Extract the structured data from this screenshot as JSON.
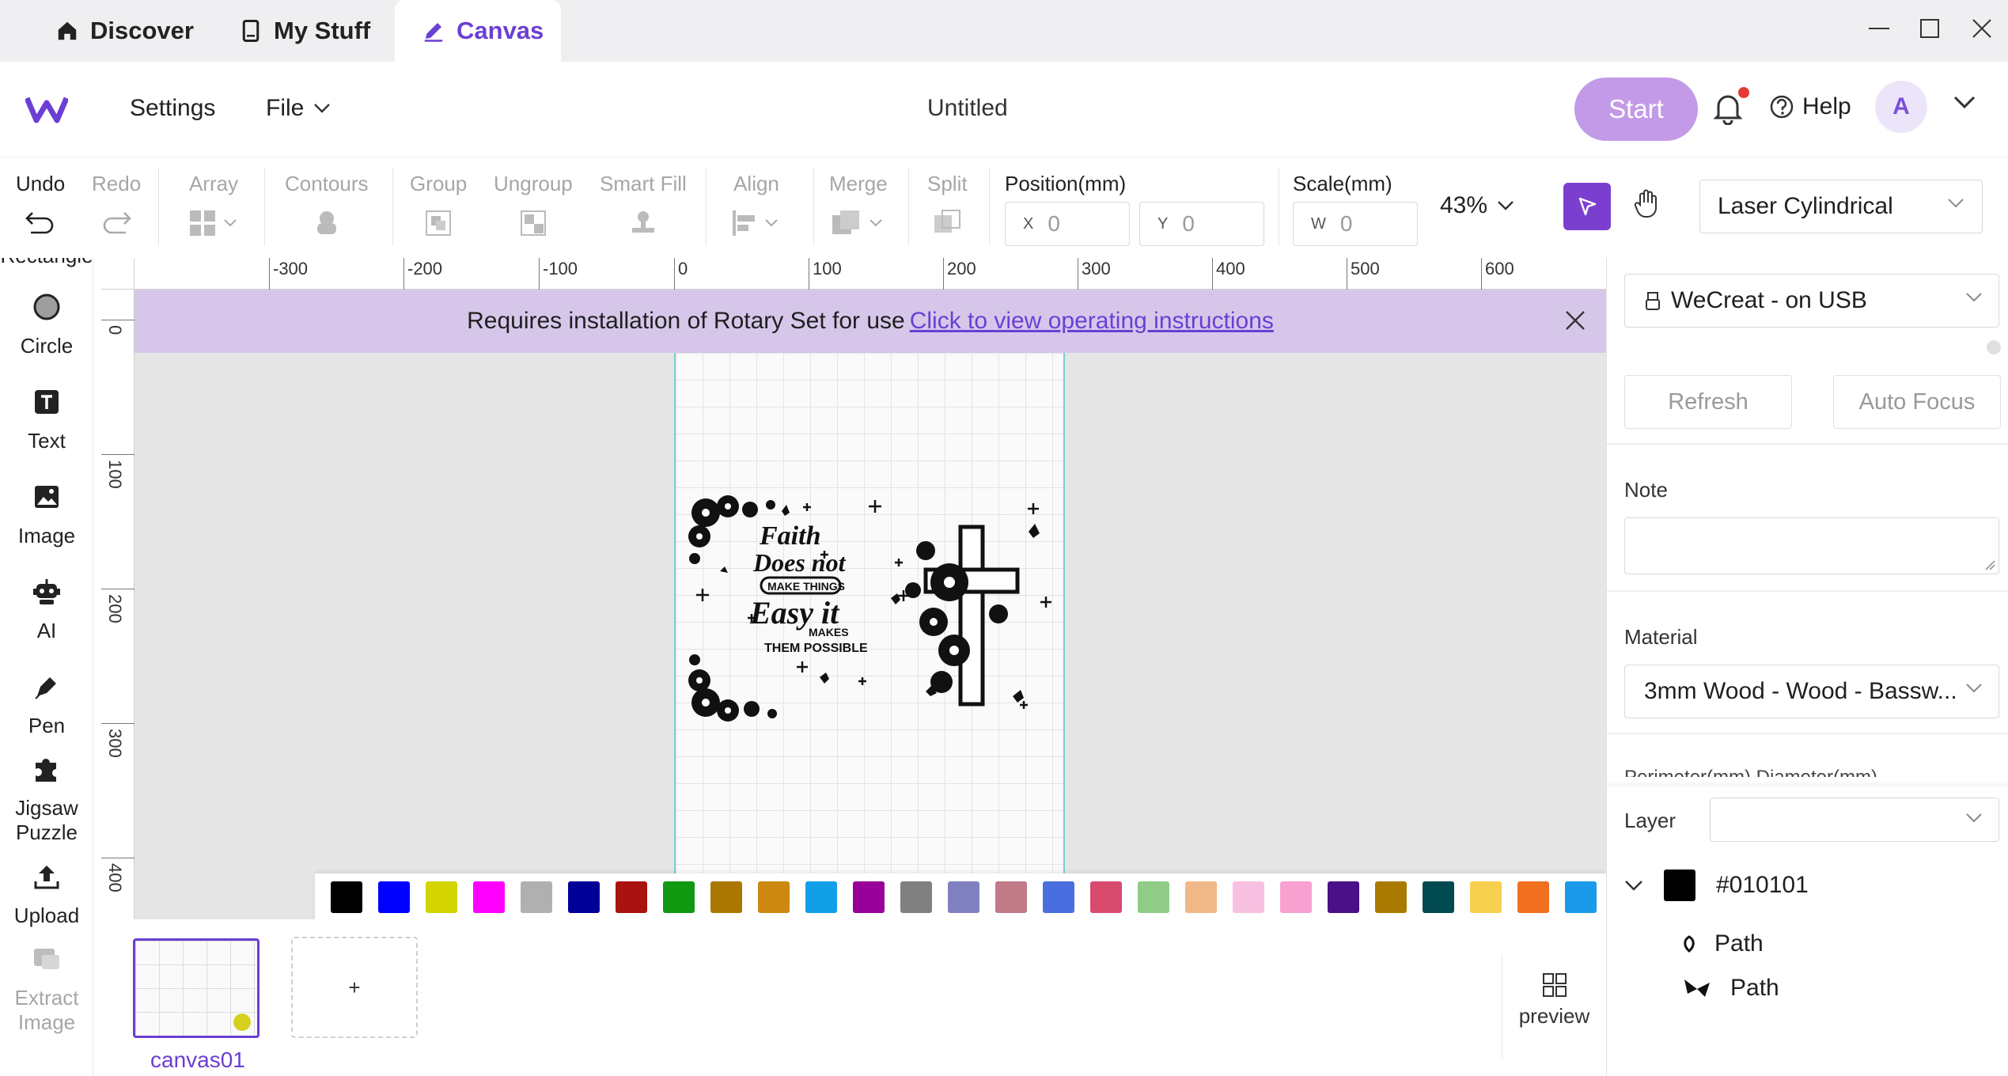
{
  "tabs": {
    "discover": "Discover",
    "my_stuff": "My Stuff",
    "canvas": "Canvas"
  },
  "header": {
    "settings": "Settings",
    "file": "File",
    "title": "Untitled",
    "start": "Start",
    "help": "Help",
    "avatar_letter": "A"
  },
  "toolbar": {
    "undo": "Undo",
    "redo": "Redo",
    "array": "Array",
    "contours": "Contours",
    "group": "Group",
    "ungroup": "Ungroup",
    "smart_fill": "Smart Fill",
    "align": "Align",
    "merge": "Merge",
    "split": "Split",
    "position_label": "Position(mm)",
    "pos_x_prefix": "X",
    "pos_x": "0",
    "pos_y_prefix": "Y",
    "pos_y": "0",
    "scale_label": "Scale(mm)",
    "scale_w_prefix": "W",
    "scale_w": "0",
    "zoom": "43%",
    "machine": "Laser Cylindrical"
  },
  "left_tools": {
    "rectangle_partial": "Rectangle",
    "circle": "Circle",
    "text": "Text",
    "image": "Image",
    "ai": "AI",
    "pen": "Pen",
    "jigsaw_line1": "Jigsaw",
    "jigsaw_line2": "Puzzle",
    "upload": "Upload",
    "extract_line1": "Extract",
    "extract_line2": "Image"
  },
  "rulers": {
    "horizontal": [
      "-300",
      "-200",
      "-100",
      "0",
      "100",
      "200",
      "300",
      "400",
      "500",
      "600"
    ],
    "vertical": [
      "0",
      "100",
      "200",
      "300",
      "400"
    ]
  },
  "notice": {
    "text": "Requires installation of Rotary Set for use",
    "link": "Click to view operating instructions"
  },
  "palette": {
    "colors": [
      "#000000",
      "#0000ff",
      "#d4d400",
      "#ff00ff",
      "#b0b0b0",
      "#000099",
      "#aa1111",
      "#119911",
      "#aa7700",
      "#cc8811",
      "#11a0e8",
      "#990099",
      "#808080",
      "#8080c0",
      "#c07a88",
      "#4a6ee0",
      "#d84a6e",
      "#90cc88",
      "#f0b888",
      "#f8c0e0",
      "#f8a0d0",
      "#4a1088",
      "#aa7a00",
      "#004a50",
      "#f8d050",
      "#f07020",
      "#1a9ae8"
    ]
  },
  "canvases": {
    "thumb_label": "canvas01",
    "add": "+",
    "preview": "preview"
  },
  "right_panel": {
    "device": "WeCreat - on USB",
    "refresh": "Refresh",
    "auto_focus": "Auto Focus",
    "note_label": "Note",
    "material_label": "Material",
    "material_value": "3mm Wood - Wood - Bassw...",
    "perimeter_partial": "Perimeter(mm)  Diameter(mm)",
    "layer_label": "Layer",
    "layer_color_name": "#010101",
    "path1": "Path",
    "path2": "Path"
  },
  "design": {
    "line1": "Faith",
    "line2": "Does not",
    "line3": "MAKE THINGS",
    "line4": "Easy it",
    "line5": "MAKES",
    "line6": "THEM POSSIBLE"
  }
}
